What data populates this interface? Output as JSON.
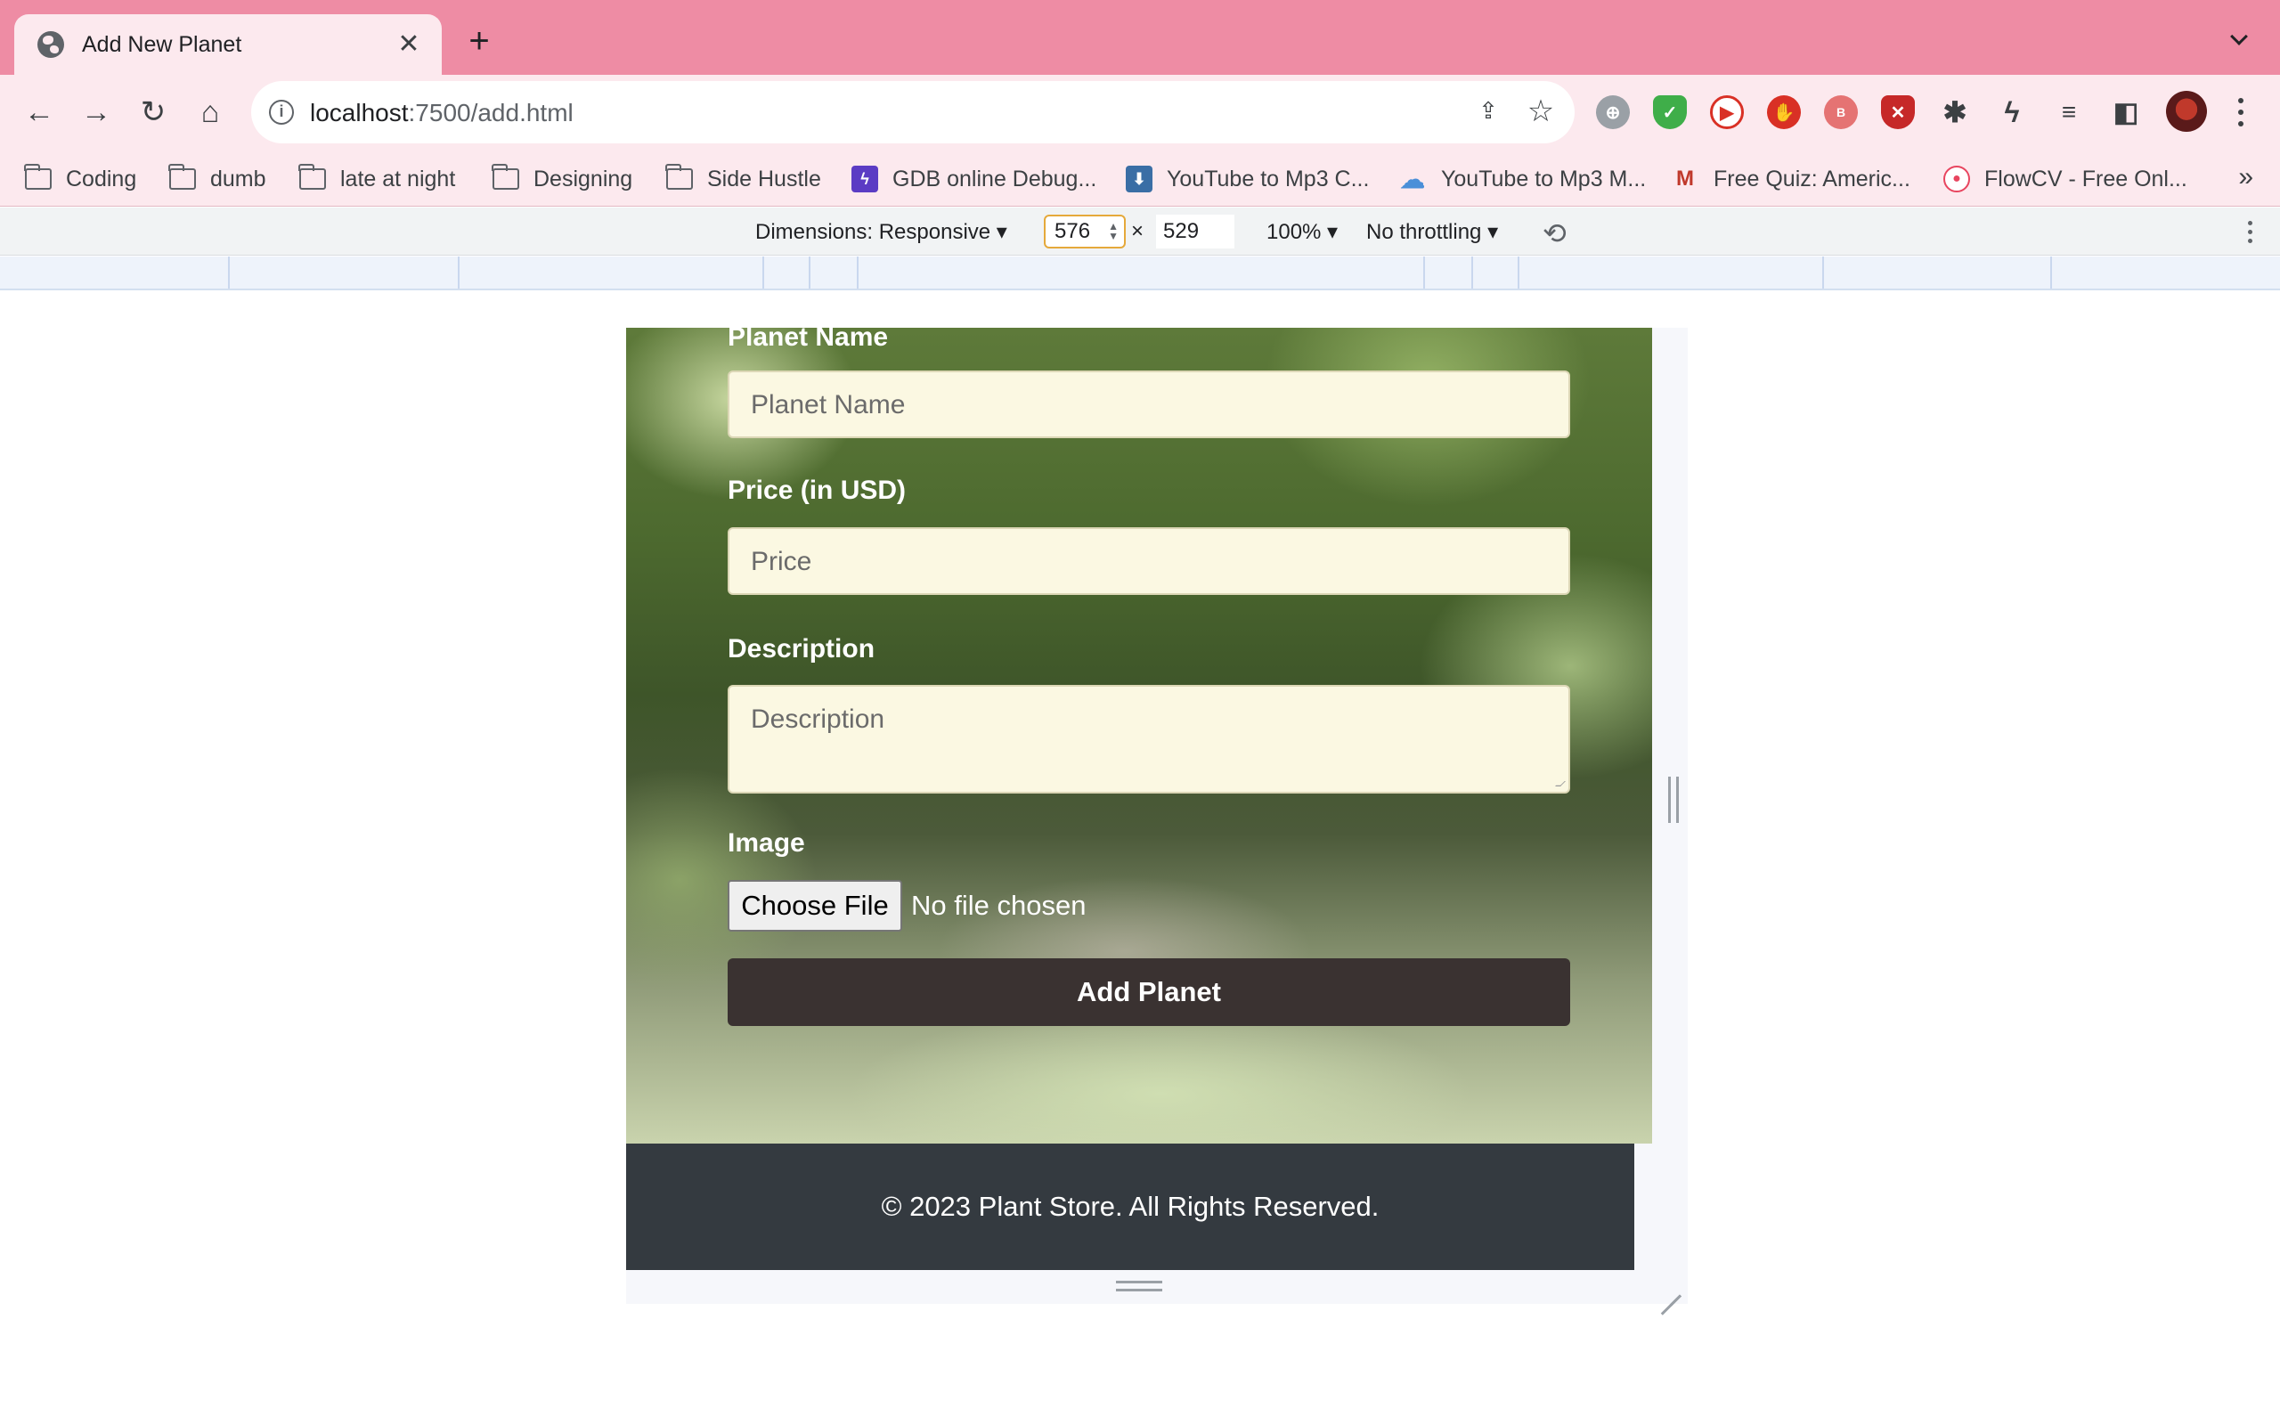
{
  "tab": {
    "title": "Add New Planet",
    "close_glyph": "✕",
    "new_tab_glyph": "+"
  },
  "toolbar": {
    "url_host": "localhost",
    "url_path": ":7500/add.html"
  },
  "bookmarks": [
    {
      "label": "Coding",
      "icon": "folder-icon"
    },
    {
      "label": "dumb",
      "icon": "folder-icon"
    },
    {
      "label": "late at night",
      "icon": "folder-icon"
    },
    {
      "label": "Designing",
      "icon": "folder-icon"
    },
    {
      "label": "Side Hustle",
      "icon": "folder-icon"
    },
    {
      "label": "GDB online Debug...",
      "icon": "gdb-icon",
      "color": "#5b3cc4"
    },
    {
      "label": "YouTube to Mp3 C...",
      "icon": "download-icon",
      "color": "#3a6ea5"
    },
    {
      "label": "YouTube to Mp3 M...",
      "icon": "cloud-download-icon",
      "color": "#4a8fd8"
    },
    {
      "label": "Free Quiz: Americ...",
      "icon": "quiz-icon",
      "color": "#c0392b"
    },
    {
      "label": "FlowCV - Free Onl...",
      "icon": "flowcv-icon",
      "color": "#e8455f"
    }
  ],
  "devtools": {
    "dimensions_label": "Dimensions: Responsive ▾",
    "width_value": "576",
    "times": "×",
    "height_value": "529",
    "zoom": "100% ▾",
    "throttling": "No throttling ▾"
  },
  "form": {
    "name_label": "Planet Name",
    "name_placeholder": "Planet Name",
    "price_label": "Price (in USD)",
    "price_placeholder": "Price",
    "description_label": "Description",
    "description_placeholder": "Description",
    "image_label": "Image",
    "file_button": "Choose File",
    "file_status": "No file chosen",
    "submit": "Add Planet"
  },
  "footer": {
    "text": "© 2023 Plant Store. All Rights Reserved."
  },
  "colors": {
    "tabstrip": "#ee8ca4",
    "toolbar": "#fce9ee",
    "input_bg": "#fbf8e2",
    "submit_bg": "#3a3231",
    "footer_bg": "#343a40"
  }
}
